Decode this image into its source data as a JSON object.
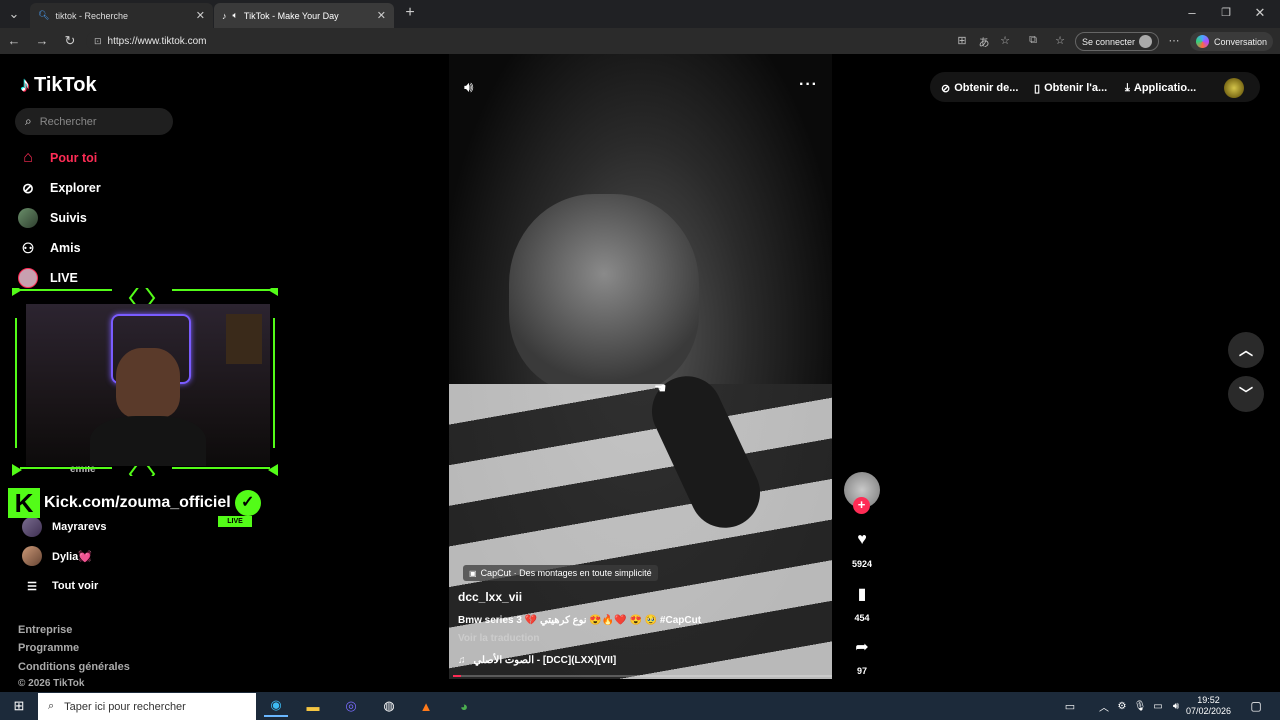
{
  "browser": {
    "tabs": [
      {
        "title": "tiktok - Recherche",
        "icon": "search-favicon"
      },
      {
        "title": "TikTok - Make Your Day",
        "icon": "tiktok-favicon"
      }
    ],
    "url": "https://www.tiktok.com",
    "signin_label": "Se connecter",
    "conversation_label": "Conversation"
  },
  "sidebar": {
    "logo_text": "TikTok",
    "search_placeholder": "Rechercher",
    "nav": [
      {
        "label": "Pour toi",
        "icon": "home-icon",
        "active": true
      },
      {
        "label": "Explorer",
        "icon": "compass-icon"
      },
      {
        "label": "Suivis",
        "icon": "following-avatar"
      },
      {
        "label": "Amis",
        "icon": "friends-icon"
      },
      {
        "label": "LIVE",
        "icon": "live-icon"
      }
    ],
    "partial_label": "emile",
    "accounts": [
      {
        "name": "Mayrarevs"
      },
      {
        "name": "Dylia💓"
      }
    ],
    "see_all": "Tout voir",
    "footer": [
      "Entreprise",
      "Programme",
      "Conditions générales"
    ],
    "copyright": "© 2026 TikTok"
  },
  "overlay": {
    "kick_handle": "Kick.com/zouma_officiel",
    "live_badge": "LIVE"
  },
  "video": {
    "capcut_label": "CapCut · Des montages en toute simplicité",
    "author": "dcc_lxx_vii",
    "description": "Bmw series 3 💔 نوع كرهيتي 😍🔥❤️ 😍 🥹 #CapCut",
    "translate_label": "Voir la traduction",
    "music": "الصوت الأصلي - [DCC](LXX)[VII]",
    "progress": 0.02,
    "likes": "5924",
    "saves": "454",
    "shares": "97"
  },
  "topright": {
    "coins_label": "Obtenir de...",
    "app_label": "Obtenir l'a...",
    "download_label": "Applicatio..."
  },
  "taskbar": {
    "search_placeholder": "Taper ici pour rechercher",
    "time": "19:52",
    "date": "07/02/2026"
  },
  "colors": {
    "accent": "#fe2c55",
    "kick_green": "#53fc18"
  }
}
